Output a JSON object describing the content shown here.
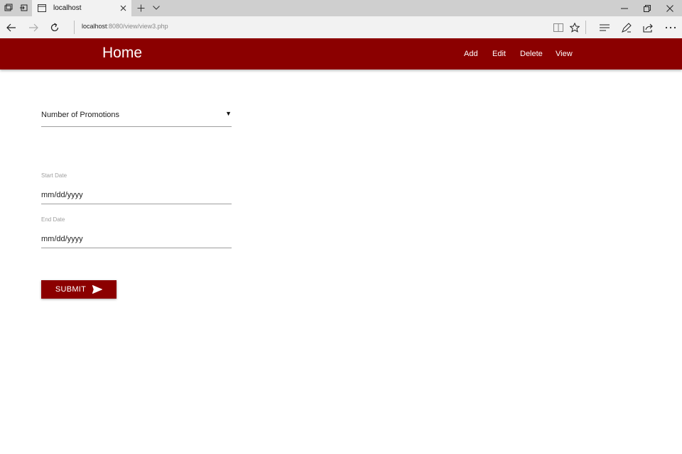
{
  "browser": {
    "tab_title": "localhost",
    "url_host": "localhost",
    "url_rest": ":8080/view/view3.php"
  },
  "header": {
    "brand": "Home",
    "nav": [
      "Add",
      "Edit",
      "Delete",
      "View"
    ]
  },
  "form": {
    "select_value": "Number of Promotions",
    "start_label": "Start Date",
    "start_placeholder": "mm/dd/yyyy",
    "end_label": "End Date",
    "end_placeholder": "mm/dd/yyyy",
    "submit_label": "SUBMIT"
  },
  "colors": {
    "accent": "#8b0000",
    "tabbar": "#cfcfcf",
    "toolbar": "#f2f2f2"
  },
  "icons": {
    "submit": "send-icon",
    "select_caret": "caret-down-icon"
  }
}
